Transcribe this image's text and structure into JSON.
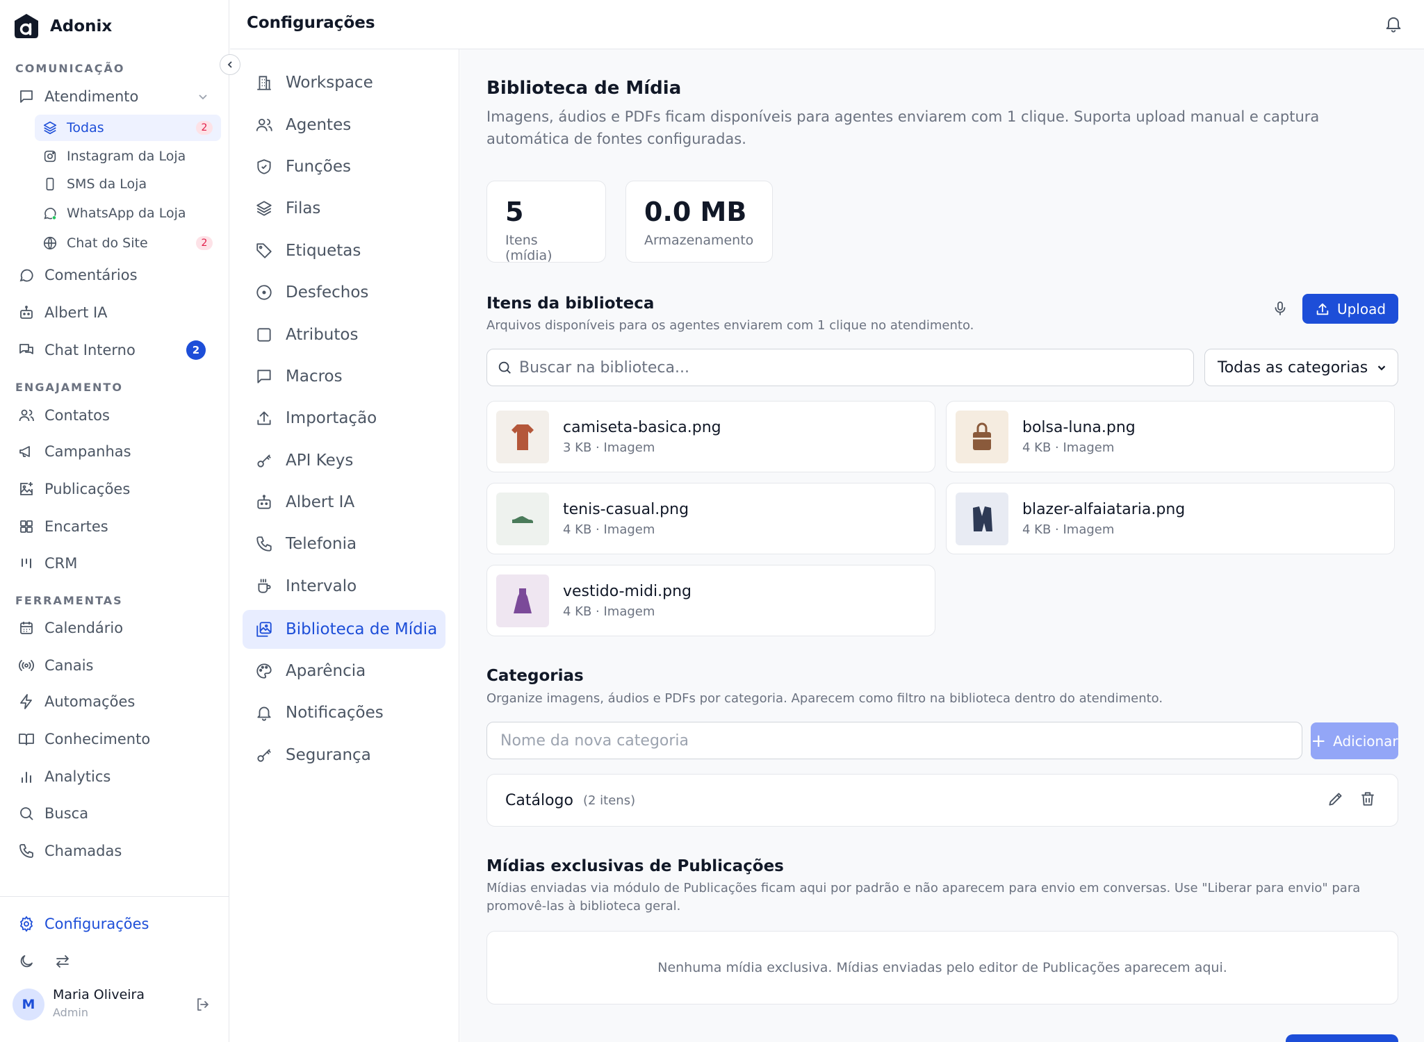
{
  "brand": {
    "name": "Adonix"
  },
  "sidebar": {
    "sections": {
      "comunicacao": "COMUNICAÇÃO",
      "engajamento": "ENGAJAMENTO",
      "ferramentas": "FERRAMENTAS"
    },
    "atendimento": {
      "label": "Atendimento",
      "children": [
        {
          "label": "Todas",
          "badge": "2",
          "icon": "layers-icon"
        },
        {
          "label": "Instagram da Loja",
          "icon": "instagram-icon"
        },
        {
          "label": "SMS da Loja",
          "icon": "phone-icon"
        },
        {
          "label": "WhatsApp da Loja",
          "icon": "whatsapp-icon"
        },
        {
          "label": "Chat do Site",
          "badge": "2",
          "icon": "globe-icon"
        }
      ]
    },
    "comunicacao_items": [
      {
        "label": "Comentários",
        "icon": "comment-icon"
      },
      {
        "label": "Albert IA",
        "icon": "bot-icon"
      },
      {
        "label": "Chat Interno",
        "badge": "2",
        "icon": "chat-icon"
      }
    ],
    "engajamento_items": [
      {
        "label": "Contatos",
        "icon": "users-icon"
      },
      {
        "label": "Campanhas",
        "icon": "megaphone-icon"
      },
      {
        "label": "Publicações",
        "icon": "image-plus-icon"
      },
      {
        "label": "Encartes",
        "icon": "grid-icon"
      },
      {
        "label": "CRM",
        "icon": "kanban-icon"
      }
    ],
    "ferramentas_items": [
      {
        "label": "Calendário",
        "icon": "calendar-icon"
      },
      {
        "label": "Canais",
        "icon": "radio-icon"
      },
      {
        "label": "Automações",
        "icon": "zap-icon"
      },
      {
        "label": "Conhecimento",
        "icon": "book-icon"
      },
      {
        "label": "Analytics",
        "icon": "bar-chart-icon"
      },
      {
        "label": "Busca",
        "icon": "search-icon"
      },
      {
        "label": "Chamadas",
        "icon": "phone-call-icon"
      }
    ],
    "settings_label": "Configurações",
    "user": {
      "initial": "M",
      "name": "Maria Oliveira",
      "role": "Admin"
    }
  },
  "topbar": {
    "title": "Configurações"
  },
  "settings_menu": [
    {
      "label": "Workspace",
      "icon": "building-icon"
    },
    {
      "label": "Agentes",
      "icon": "users-icon"
    },
    {
      "label": "Funções",
      "icon": "shield-icon"
    },
    {
      "label": "Filas",
      "icon": "layers-icon"
    },
    {
      "label": "Etiquetas",
      "icon": "tag-icon"
    },
    {
      "label": "Desfechos",
      "icon": "circle-dot-icon"
    },
    {
      "label": "Atributos",
      "icon": "square-icon"
    },
    {
      "label": "Macros",
      "icon": "message-icon"
    },
    {
      "label": "Importação",
      "icon": "upload-icon"
    },
    {
      "label": "API Keys",
      "icon": "key-icon"
    },
    {
      "label": "Albert IA",
      "icon": "bot-icon"
    },
    {
      "label": "Telefonia",
      "icon": "phone-icon"
    },
    {
      "label": "Intervalo",
      "icon": "coffee-icon"
    },
    {
      "label": "Biblioteca de Mídia",
      "icon": "images-icon",
      "active": true
    },
    {
      "label": "Aparência",
      "icon": "palette-icon"
    },
    {
      "label": "Notificações",
      "icon": "bell-icon"
    },
    {
      "label": "Segurança",
      "icon": "key-icon"
    }
  ],
  "main": {
    "title": "Biblioteca de Mídia",
    "description": "Imagens, áudios e PDFs ficam disponíveis para agentes enviarem com 1 clique. Suporta upload manual e captura automática de fontes configuradas.",
    "stats": [
      {
        "value": "5",
        "label": "Itens (mídia)"
      },
      {
        "value": "0.0 MB",
        "label": "Armazenamento"
      }
    ],
    "library": {
      "title": "Itens da biblioteca",
      "description": "Arquivos disponíveis para os agentes enviarem com 1 clique no atendimento.",
      "upload_label": "Upload",
      "search_placeholder": "Buscar na biblioteca...",
      "category_filter": "Todas as categorias",
      "items": [
        {
          "name": "camiseta-basica.png",
          "meta": "3 KB · Imagem",
          "thumb_icon": "tshirt-icon",
          "thumb_bg": "#f3efea",
          "thumb_color": "#b4573a"
        },
        {
          "name": "bolsa-luna.png",
          "meta": "4 KB · Imagem",
          "thumb_icon": "bag-icon",
          "thumb_bg": "#f5ece0",
          "thumb_color": "#8a5a3b"
        },
        {
          "name": "tenis-casual.png",
          "meta": "4 KB · Imagem",
          "thumb_icon": "shoe-icon",
          "thumb_bg": "#eef2ee",
          "thumb_color": "#4a7b5a"
        },
        {
          "name": "blazer-alfaiataria.png",
          "meta": "4 KB · Imagem",
          "thumb_icon": "blazer-icon",
          "thumb_bg": "#e8ebf3",
          "thumb_color": "#2e3a55"
        },
        {
          "name": "vestido-midi.png",
          "meta": "4 KB · Imagem",
          "thumb_icon": "dress-icon",
          "thumb_bg": "#efe6f1",
          "thumb_color": "#7b4a99"
        }
      ]
    },
    "categories": {
      "title": "Categorias",
      "description": "Organize imagens, áudios e PDFs por categoria. Aparecem como filtro na biblioteca dentro do atendimento.",
      "input_placeholder": "Nome da nova categoria",
      "add_label": "Adicionar",
      "items": [
        {
          "name": "Catálogo",
          "count": "(2 itens)"
        }
      ]
    },
    "exclusive": {
      "title": "Mídias exclusivas de Publicações",
      "description": "Mídias enviadas via módulo de Publicações ficam aqui por padrão e não aparecem para envio em conversas. Use \"Liberar para envio\" para promovê-las à biblioteca geral.",
      "empty": "Nenhuma mídia exclusiva. Mídias enviadas pelo editor de Publicações aparecem aqui."
    }
  },
  "colors": {
    "accent": "#1d4ed8",
    "badge_red": "#e11d48"
  }
}
